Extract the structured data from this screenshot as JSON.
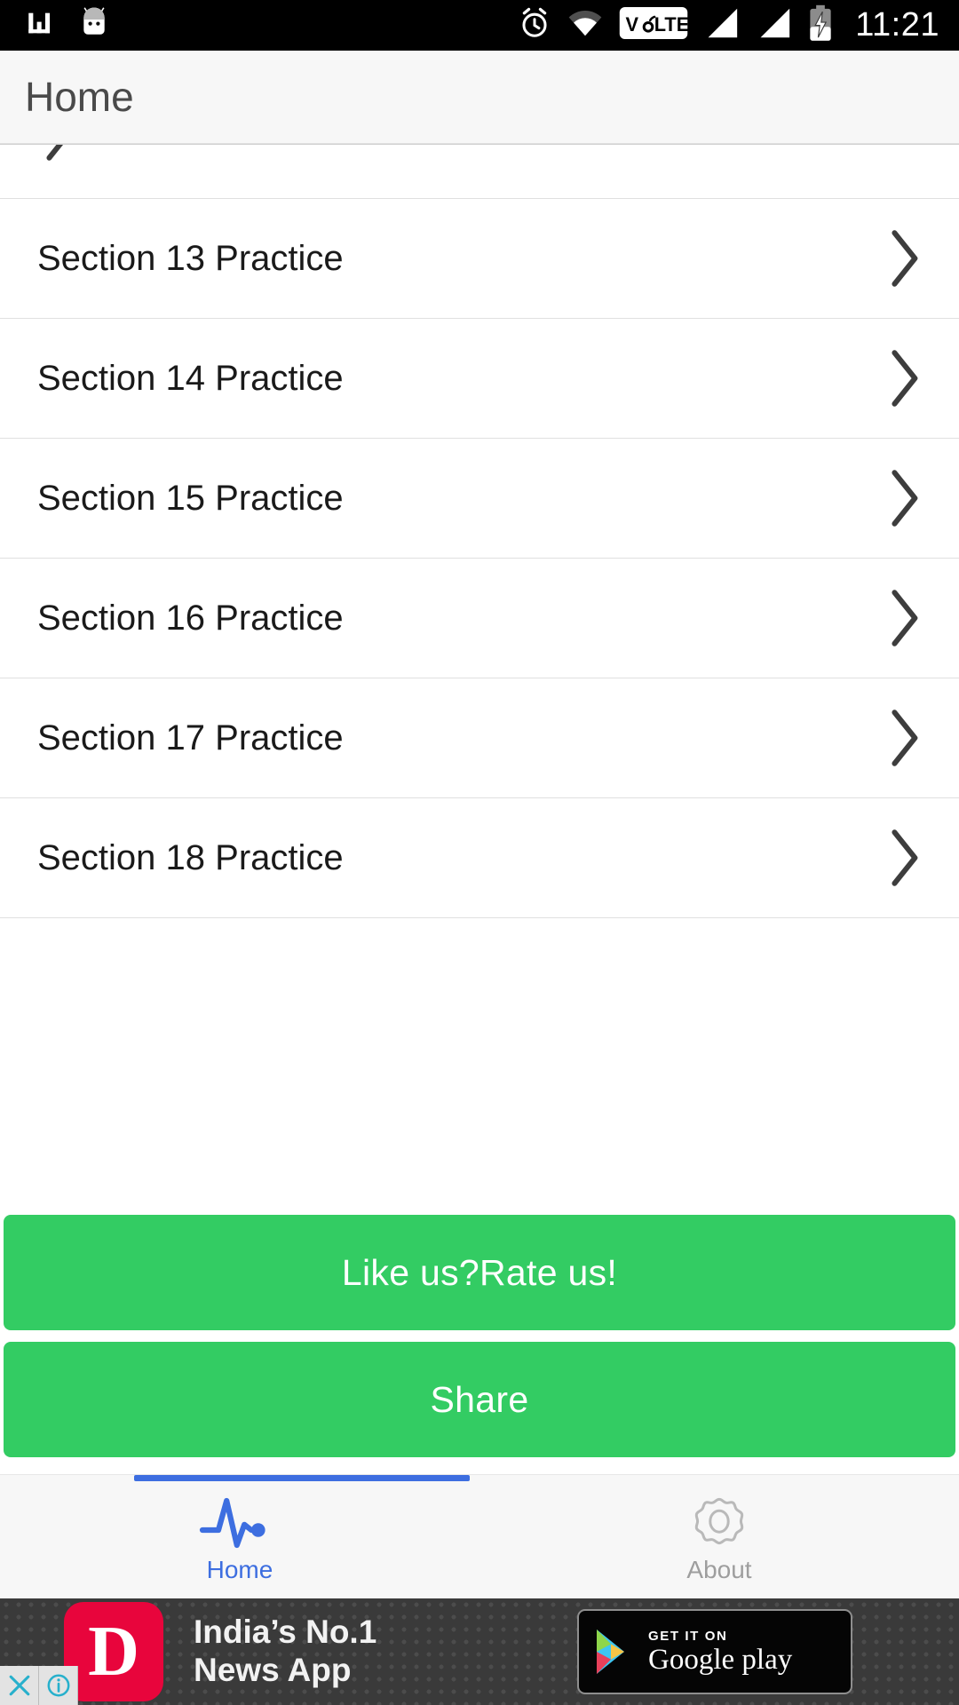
{
  "status_bar": {
    "time": "11:21",
    "left_icons": [
      "bar-chart-icon",
      "android-mascot-icon"
    ],
    "right_icons": [
      "alarm-icon",
      "wifi-icon",
      "volte-badge",
      "signal-1-icon",
      "signal-2-icon",
      "battery-charging-icon"
    ],
    "volte_label": "VoLTE",
    "background": "#000000",
    "foreground": "#ffffff"
  },
  "app_bar": {
    "title": "Home",
    "background": "#f7f7f7",
    "title_color": "#4a4a4a"
  },
  "list": {
    "partial_top_row": {
      "label": "",
      "chevron": "chevron-right-icon"
    },
    "rows": [
      {
        "label": "Section 13 Practice",
        "chevron": "chevron-right-icon"
      },
      {
        "label": "Section 14 Practice",
        "chevron": "chevron-right-icon"
      },
      {
        "label": "Section 15 Practice",
        "chevron": "chevron-right-icon"
      },
      {
        "label": "Section 16 Practice",
        "chevron": "chevron-right-icon"
      },
      {
        "label": "Section 17 Practice",
        "chevron": "chevron-right-icon"
      },
      {
        "label": "Section 18 Practice",
        "chevron": "chevron-right-icon"
      }
    ],
    "row_text_color": "#1a1a1a",
    "divider_color": "#e0e0e0"
  },
  "actions": {
    "rate_label": "Like us?Rate us!",
    "share_label": "Share",
    "button_color": "#33cc63",
    "button_text_color": "#ffffff"
  },
  "tabs": {
    "active_index": 0,
    "indicator_color": "#3d6ee0",
    "active_color": "#3d6ee0",
    "inactive_color": "#9e9e9e",
    "items": [
      {
        "label": "Home",
        "icon": "pulse-heartbeat-icon",
        "active": true
      },
      {
        "label": "About",
        "icon": "gear-icon",
        "active": false
      }
    ]
  },
  "ad": {
    "logo_letter": "D",
    "logo_color": "#e8053c",
    "headline_line1": "India’s No.1",
    "headline_line2": "News App",
    "store_badge_small": "GET IT ON",
    "store_badge_name": "Google play",
    "close_icon": "close-x-icon",
    "info_icon": "info-icon",
    "background": "#3a3a3a",
    "control_color": "#27b0cc"
  }
}
